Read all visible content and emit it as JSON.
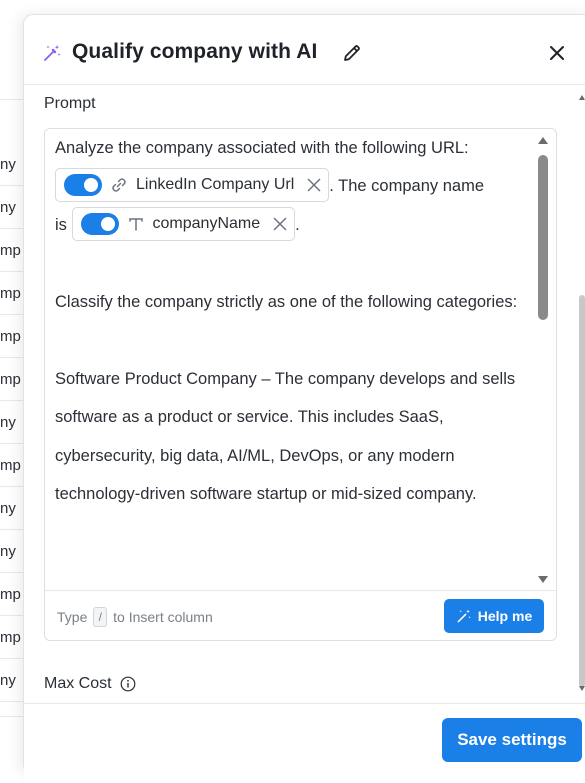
{
  "background_rows": [
    "ny",
    "ny",
    "mp",
    "mp",
    "mp",
    "mp",
    "ny",
    "mp",
    "ny",
    "ny",
    "mp",
    "mp",
    "ny"
  ],
  "header": {
    "title": "Qualify company with AI"
  },
  "prompt": {
    "label": "Prompt",
    "line1": "Analyze the company associated with the following URL:",
    "chip1": {
      "label": "LinkedIn Company Url",
      "icon": "link-icon",
      "enabled": true
    },
    "after_chip1": ". The company name",
    "is_text": "is",
    "chip2": {
      "label": "companyName",
      "icon": "text-type-icon",
      "enabled": true
    },
    "after_chip2": ".",
    "para2": "Classify the company strictly as one of the following categories:",
    "para3": "Software Product Company – The company develops and sells software as a product or service. This includes SaaS, cybersecurity, big data, AI/ML, DevOps, or any modern technology-driven software startup or mid-sized company.",
    "hint_before": "Type",
    "hint_key": "/",
    "hint_after": "to Insert column",
    "help_button": "Help me"
  },
  "max_cost": {
    "label": "Max Cost"
  },
  "footer": {
    "save_button": "Save settings"
  },
  "colors": {
    "accent": "#1a7fe6",
    "wand": "#8b5cf6"
  }
}
